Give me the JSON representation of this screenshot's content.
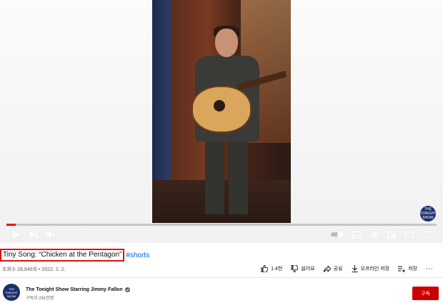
{
  "player": {
    "time_display": "0:01 / 0:45",
    "progress": 0.022,
    "accent_color": "#ff0000",
    "watermark_text": "THE TONIGHT SHOW",
    "icons": [
      "play-icon",
      "next-icon",
      "volume-icon",
      "autoplay-toggle-icon",
      "subtitles-icon",
      "settings-icon",
      "miniplayer-icon",
      "theater-icon",
      "fullscreen-icon"
    ]
  },
  "video": {
    "title": "Tiny Song: “Chicken at the Pentagon”",
    "hashtag": "#shorts",
    "meta": "조회수 28,846회 • 2022. 2. 2."
  },
  "actions": {
    "like": "1.4천",
    "dislike": "싫어요",
    "share": "공유",
    "offline": "오프라인 저장",
    "save": "저장",
    "more": "⋯"
  },
  "channel": {
    "name": "The Tonight Show Starring Jimmy Fallon",
    "subscribers": "구독자 291만명",
    "verified_icon": "check-circle-icon",
    "avatar_text": "THE TONIGHT SHOW",
    "subscribe_label": "구독",
    "subscribe_color": "#cc0000"
  }
}
